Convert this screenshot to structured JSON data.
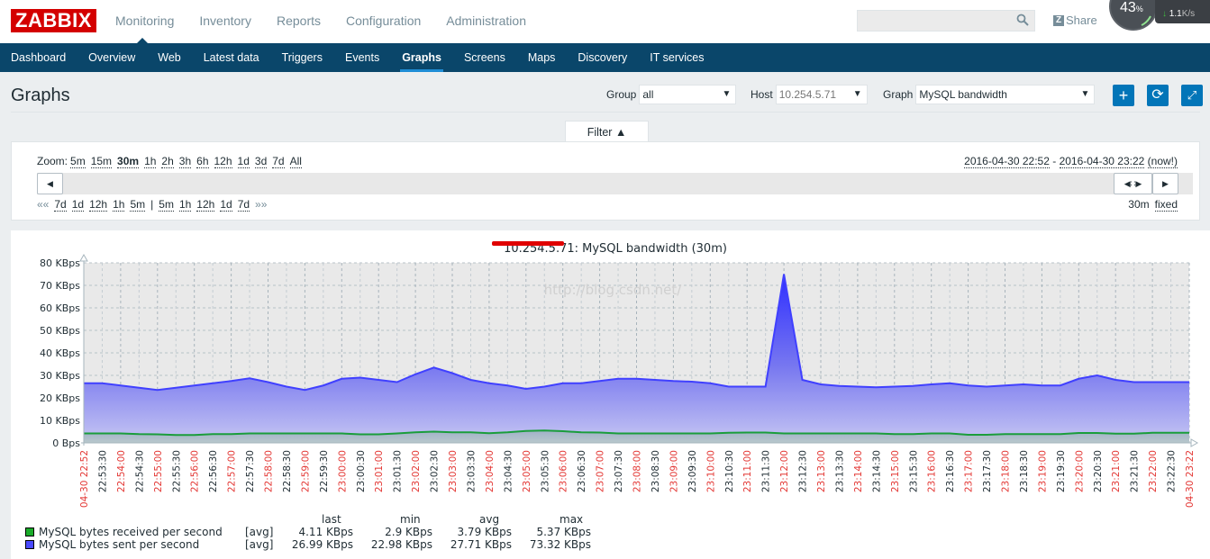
{
  "brand": {
    "logo": "ZABBIX",
    "color": "#d40000"
  },
  "main_menu": [
    {
      "label": "Monitoring",
      "active": true
    },
    {
      "label": "Inventory"
    },
    {
      "label": "Reports"
    },
    {
      "label": "Configuration"
    },
    {
      "label": "Administration"
    }
  ],
  "top_right": {
    "search_placeholder": "",
    "share_label": "Share",
    "share_icon": "Z",
    "widget_percent": "43",
    "widget_percent_sign": "%",
    "net_speed": "1.1",
    "net_unit": "K/s",
    "help": "?"
  },
  "sub_menu": [
    {
      "label": "Dashboard"
    },
    {
      "label": "Overview"
    },
    {
      "label": "Web"
    },
    {
      "label": "Latest data"
    },
    {
      "label": "Triggers"
    },
    {
      "label": "Events"
    },
    {
      "label": "Graphs",
      "active": true
    },
    {
      "label": "Screens"
    },
    {
      "label": "Maps"
    },
    {
      "label": "Discovery"
    },
    {
      "label": "IT services"
    }
  ],
  "page": {
    "title": "Graphs",
    "group_label": "Group",
    "group_value": "all",
    "host_label": "Host",
    "host_value": "10.254.5.71",
    "graph_label": "Graph",
    "graph_value": "MySQL bandwidth"
  },
  "filter": {
    "tab_label": "Filter ▲",
    "zoom_label": "Zoom:",
    "zoom_options": [
      "5m",
      "15m",
      "30m",
      "1h",
      "2h",
      "3h",
      "6h",
      "12h",
      "1d",
      "3d",
      "7d",
      "All"
    ],
    "zoom_selected": "30m",
    "range_from": "2016-04-30 22:52",
    "range_sep": " - ",
    "range_to": "2016-04-30 23:22",
    "range_now": "(now!)",
    "nav_back_start": "««",
    "nav_back": [
      "7d",
      "1d",
      "12h",
      "1h",
      "5m"
    ],
    "nav_sep": "|",
    "nav_fwd": [
      "5m",
      "1h",
      "12h",
      "1d",
      "7d"
    ],
    "nav_fwd_end": "»»",
    "period": "30m",
    "fixed": "fixed"
  },
  "chart_data": {
    "type": "area",
    "title": "10.254.5.71: MySQL bandwidth (30m)",
    "watermark": "http://blog.csdn.net/",
    "ylabel": "",
    "ylim": [
      0,
      80
    ],
    "y_ticks": [
      "0 Bps",
      "10 KBps",
      "20 KBps",
      "30 KBps",
      "40 KBps",
      "50 KBps",
      "60 KBps",
      "70 KBps",
      "80 KBps"
    ],
    "x_labels": [
      "04-30 22:52",
      "22:53:30",
      "22:54:00",
      "22:54:30",
      "22:55:00",
      "22:55:30",
      "22:56:00",
      "22:56:30",
      "22:57:00",
      "22:57:30",
      "22:58:00",
      "22:58:30",
      "22:59:00",
      "22:59:30",
      "23:00:00",
      "23:00:30",
      "23:01:00",
      "23:01:30",
      "23:02:00",
      "23:02:30",
      "23:03:00",
      "23:03:30",
      "23:04:00",
      "23:04:30",
      "23:05:00",
      "23:05:30",
      "23:06:00",
      "23:06:30",
      "23:07:00",
      "23:07:30",
      "23:08:00",
      "23:08:30",
      "23:09:00",
      "23:09:30",
      "23:10:00",
      "23:10:30",
      "23:11:00",
      "23:11:30",
      "23:12:00",
      "23:12:30",
      "23:13:00",
      "23:13:30",
      "23:14:00",
      "23:14:30",
      "23:15:00",
      "23:15:30",
      "23:16:00",
      "23:16:30",
      "23:17:00",
      "23:17:30",
      "23:18:00",
      "23:18:30",
      "23:19:00",
      "23:19:30",
      "23:20:00",
      "23:20:30",
      "23:21:00",
      "23:21:30",
      "23:22:00",
      "23:22:30",
      "04-30 23:22"
    ],
    "grid": true,
    "legend_position": "bottom-left",
    "series": [
      {
        "name": "MySQL bytes received per second",
        "func": "[avg]",
        "color": "#1a9d3b",
        "last": "4.11 KBps",
        "min": "2.9 KBps",
        "avg": "3.79 KBps",
        "max": "5.37 KBps",
        "values": [
          4.2,
          4.2,
          4.2,
          3.9,
          3.8,
          3.5,
          3.5,
          3.9,
          3.9,
          4.2,
          4.2,
          4.2,
          4.2,
          4.2,
          4.2,
          3.8,
          3.8,
          4.2,
          4.7,
          5.0,
          4.7,
          4.7,
          4.3,
          4.7,
          5.3,
          5.5,
          5.2,
          4.7,
          4.6,
          4.2,
          4.2,
          4.2,
          4.2,
          4.2,
          4.2,
          4.5,
          4.6,
          4.6,
          4.2,
          4.2,
          4.2,
          4.2,
          4.2,
          4.2,
          3.9,
          3.9,
          4.2,
          4.2,
          3.6,
          3.6,
          3.9,
          3.9,
          3.9,
          3.9,
          4.4,
          4.4,
          4.1,
          4.1,
          4.5,
          4.5,
          4.5
        ]
      },
      {
        "name": "MySQL bytes sent per second",
        "func": "[avg]",
        "color": "#4040ff",
        "last": "26.99 KBps",
        "min": "22.98 KBps",
        "avg": "27.71 KBps",
        "max": "73.32 KBps",
        "values": [
          26.5,
          26.5,
          25.5,
          24.5,
          23.5,
          24.5,
          25.5,
          26.5,
          27.5,
          28.7,
          27.0,
          25.0,
          23.5,
          25.5,
          28.5,
          29.0,
          28.0,
          27.0,
          30.5,
          33.5,
          31.0,
          28.0,
          26.5,
          25.5,
          24.0,
          25.0,
          26.5,
          26.5,
          27.5,
          28.5,
          28.5,
          28.0,
          27.5,
          27.2,
          26.5,
          25.0,
          25.0,
          25.0,
          75.0,
          28.0,
          26.0,
          25.3,
          25.0,
          24.7,
          25.0,
          25.3,
          26.0,
          26.5,
          25.5,
          25.0,
          25.5,
          26.0,
          25.5,
          25.5,
          28.5,
          30.0,
          28.0,
          27.0,
          27.0,
          27.0,
          27.0
        ]
      }
    ],
    "legend_headers": [
      "last",
      "min",
      "avg",
      "max"
    ]
  }
}
